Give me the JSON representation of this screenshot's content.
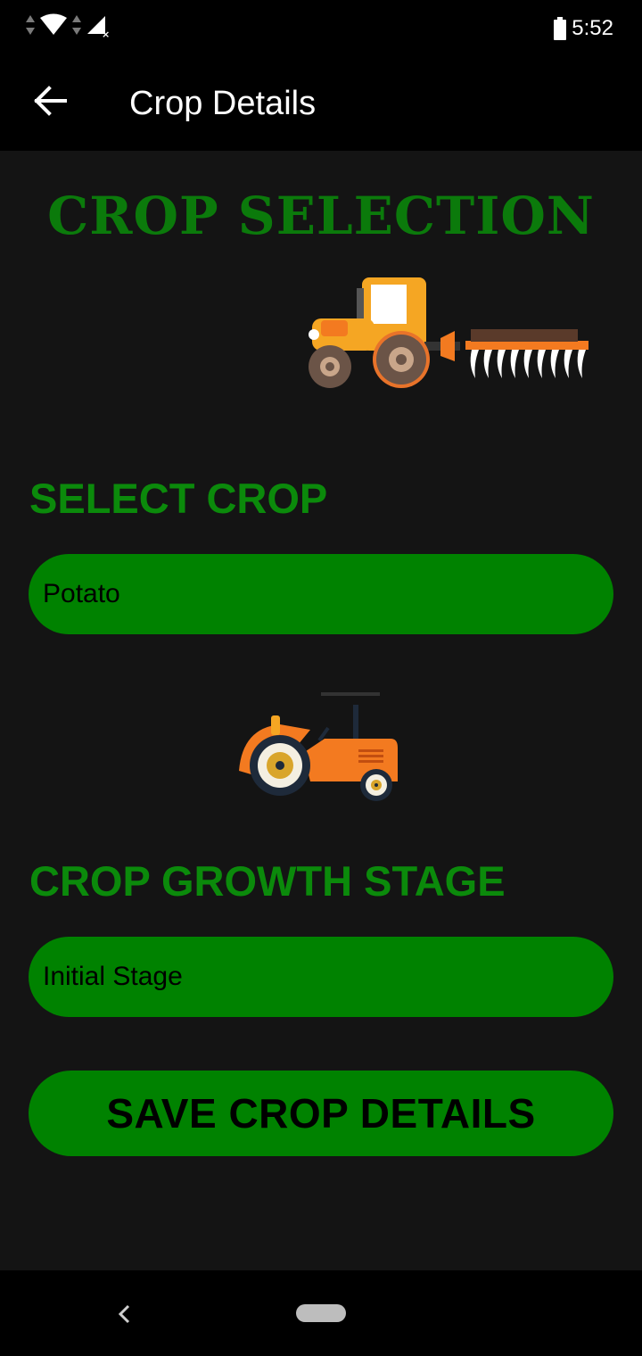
{
  "status_bar": {
    "time": "5:52",
    "icons": [
      "data-arrows-icon",
      "wifi-icon",
      "data-arrows-icon",
      "signal-no-data-icon",
      "battery-icon"
    ]
  },
  "app_bar": {
    "title": "Crop Details",
    "back_icon": "arrow-left-icon"
  },
  "main": {
    "headline": "CROP SELECTION",
    "select_crop": {
      "label": "SELECT CROP",
      "value": "Potato"
    },
    "growth_stage": {
      "label": "CROP GROWTH STAGE",
      "value": "Initial Stage"
    },
    "save_button": "SAVE CROP DETAILS"
  },
  "colors": {
    "accent_green": "#008200",
    "headline_green": "#0b7a0b",
    "background": "#141414",
    "bar_black": "#000000"
  },
  "nav_bar": {
    "icons": [
      "nav-back-icon",
      "nav-home-pill-icon"
    ]
  }
}
